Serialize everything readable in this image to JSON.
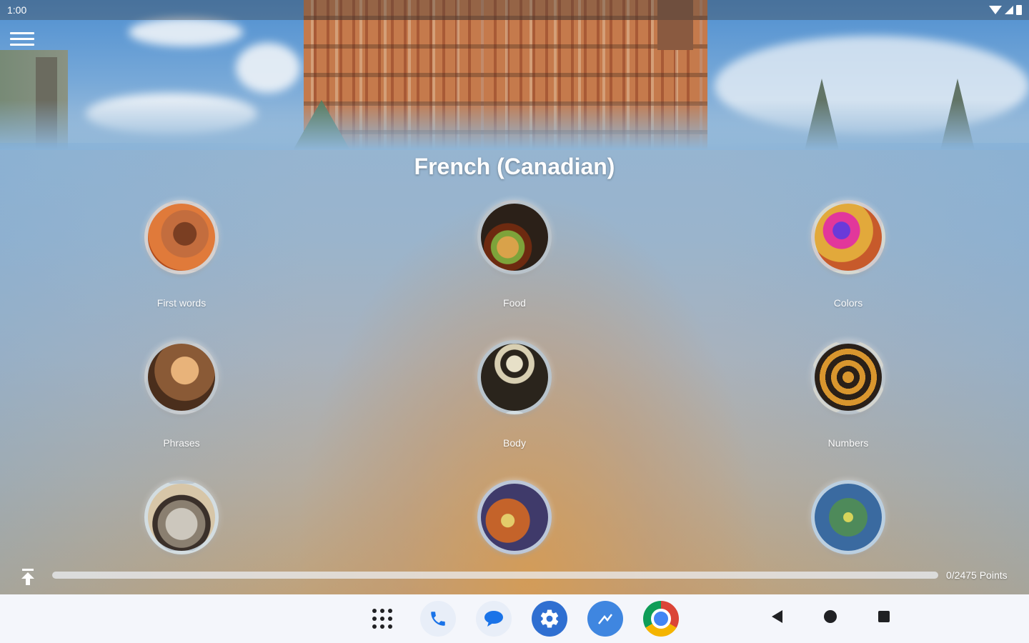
{
  "status_bar": {
    "time": "1:00"
  },
  "header": {
    "title": "French (Canadian)",
    "menu_icon": "hamburger-menu-icon"
  },
  "categories": [
    {
      "label": "First words",
      "image": "child-face-photo"
    },
    {
      "label": "Food",
      "image": "burger-photo"
    },
    {
      "label": "Colors",
      "image": "colorful-powder-photo"
    },
    {
      "label": "Phrases",
      "image": "woman-photo"
    },
    {
      "label": "Body",
      "image": "skeleton-photo"
    },
    {
      "label": "Numbers",
      "image": "number-shapes-photo"
    },
    {
      "label": "",
      "image": "alarm-clock-photo"
    },
    {
      "label": "",
      "image": "fruit-photo"
    },
    {
      "label": "",
      "image": "tree-photo"
    }
  ],
  "progress": {
    "points_text": "0/2475 Points",
    "fraction": 0
  },
  "dock": {
    "apps": [
      "app-drawer-icon",
      "phone-icon",
      "messages-icon",
      "settings-icon",
      "photos-icon",
      "chrome-icon"
    ]
  },
  "system_nav": [
    "back-icon",
    "home-icon",
    "recents-icon"
  ]
}
